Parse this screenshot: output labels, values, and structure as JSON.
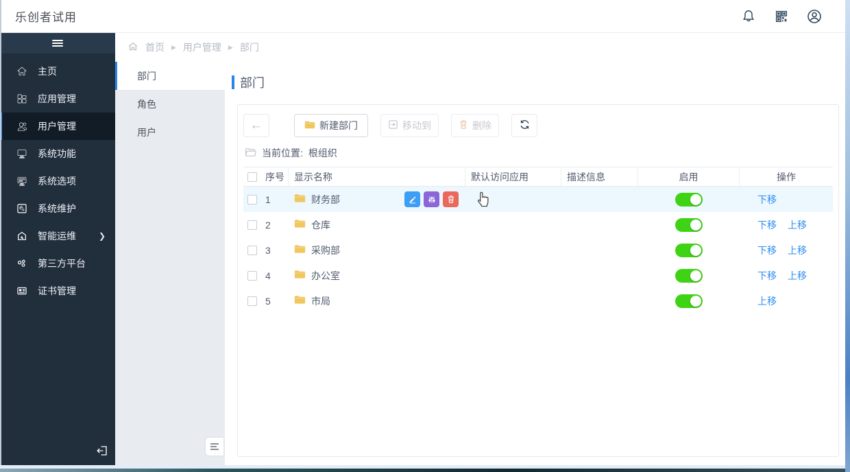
{
  "topbar": {
    "title": "乐创者试用"
  },
  "sidebar": {
    "items": [
      {
        "label": "主页",
        "icon": "home-icon",
        "active": false
      },
      {
        "label": "应用管理",
        "icon": "apps-icon",
        "active": false
      },
      {
        "label": "用户管理",
        "icon": "users-icon",
        "active": true
      },
      {
        "label": "系统功能",
        "icon": "system-functions-icon",
        "active": false
      },
      {
        "label": "系统选项",
        "icon": "system-options-icon",
        "active": false
      },
      {
        "label": "系统维护",
        "icon": "system-maintenance-icon",
        "active": false
      },
      {
        "label": "智能运维",
        "icon": "smart-ops-icon",
        "active": false,
        "has_submenu": true
      },
      {
        "label": "第三方平台",
        "icon": "third-party-icon",
        "active": false
      },
      {
        "label": "证书管理",
        "icon": "certificate-icon",
        "active": false
      }
    ]
  },
  "breadcrumb": {
    "items": [
      "首页",
      "用户管理",
      "部门"
    ]
  },
  "subsidebar": {
    "items": [
      {
        "label": "部门",
        "active": true
      },
      {
        "label": "角色",
        "active": false
      },
      {
        "label": "用户",
        "active": false
      }
    ]
  },
  "main": {
    "page_title": "部门",
    "toolbar": {
      "new_label": "新建部门",
      "move_label": "移动到",
      "delete_label": "删除"
    },
    "location": {
      "label": "当前位置:",
      "value": "根组织"
    },
    "table": {
      "headers": [
        "序号",
        "显示名称",
        "默认访问应用",
        "描述信息",
        "启用",
        "操作"
      ],
      "rows": [
        {
          "index": "1",
          "name": "财务部",
          "enabled": true,
          "actions": [
            "下移"
          ]
        },
        {
          "index": "2",
          "name": "仓库",
          "enabled": true,
          "actions": [
            "下移",
            "上移"
          ]
        },
        {
          "index": "3",
          "name": "采购部",
          "enabled": true,
          "actions": [
            "下移",
            "上移"
          ]
        },
        {
          "index": "4",
          "name": "办公室",
          "enabled": true,
          "actions": [
            "下移",
            "上移"
          ]
        },
        {
          "index": "5",
          "name": "市局",
          "enabled": true,
          "actions": [
            "上移"
          ]
        }
      ]
    }
  },
  "colors": {
    "accent_blue": "#2d8cf0",
    "toggle_on_green": "#3ed314",
    "sidebar_dark": "#212e3c",
    "action_edit_blue": "#3d9ef5",
    "action_config_purple": "#8a66d9",
    "action_delete_red": "#e9695c",
    "folder_yellow": "#f0c65f"
  }
}
